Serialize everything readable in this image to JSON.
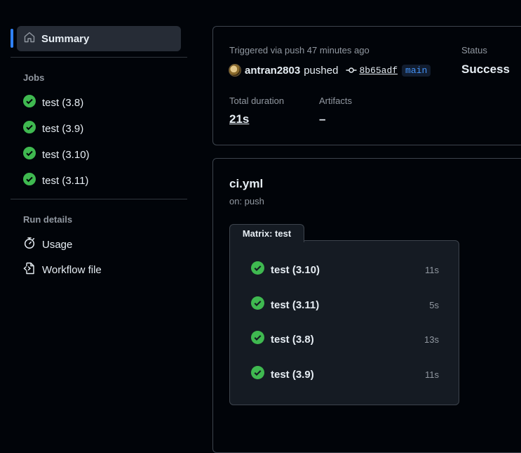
{
  "sidebar": {
    "summary_label": "Summary",
    "jobs_header": "Jobs",
    "jobs": [
      {
        "label": "test (3.8)"
      },
      {
        "label": "test (3.9)"
      },
      {
        "label": "test (3.10)"
      },
      {
        "label": "test (3.11)"
      }
    ],
    "run_details_header": "Run details",
    "details": [
      {
        "label": "Usage",
        "icon": "stopwatch-icon"
      },
      {
        "label": "Workflow file",
        "icon": "file-code-icon"
      }
    ]
  },
  "summary": {
    "trigger_text": "Triggered via push 47 minutes ago",
    "actor": "antran2803",
    "action": "pushed",
    "commit": "8b65adf",
    "branch": "main",
    "status_label": "Status",
    "status_value": "Success",
    "duration_label": "Total duration",
    "duration_value": "21s",
    "artifacts_label": "Artifacts",
    "artifacts_value": "–"
  },
  "workflow": {
    "name": "ci.yml",
    "trigger": "on: push",
    "matrix_label": "Matrix: test",
    "jobs": [
      {
        "label": "test (3.10)",
        "duration": "11s"
      },
      {
        "label": "test (3.11)",
        "duration": "5s"
      },
      {
        "label": "test (3.8)",
        "duration": "13s"
      },
      {
        "label": "test (3.9)",
        "duration": "11s"
      }
    ]
  },
  "colors": {
    "success": "#3fb950",
    "accent": "#2f81f7",
    "background": "#010409",
    "border": "#3d444d"
  }
}
